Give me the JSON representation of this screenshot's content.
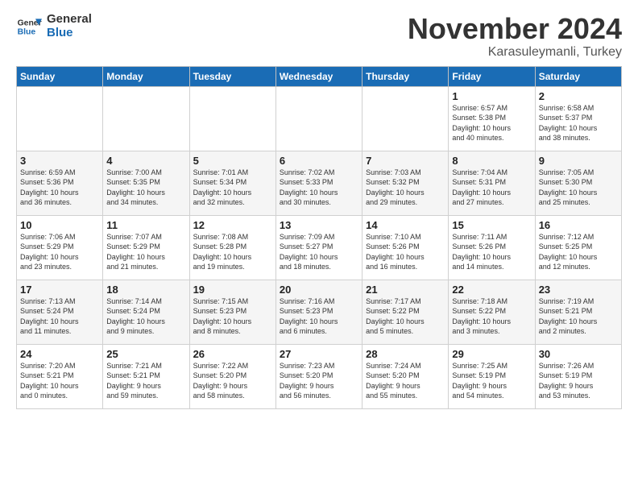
{
  "logo": {
    "line1": "General",
    "line2": "Blue"
  },
  "header": {
    "month": "November 2024",
    "location": "Karasuleymanli, Turkey"
  },
  "days_of_week": [
    "Sunday",
    "Monday",
    "Tuesday",
    "Wednesday",
    "Thursday",
    "Friday",
    "Saturday"
  ],
  "weeks": [
    [
      {
        "day": "",
        "info": ""
      },
      {
        "day": "",
        "info": ""
      },
      {
        "day": "",
        "info": ""
      },
      {
        "day": "",
        "info": ""
      },
      {
        "day": "",
        "info": ""
      },
      {
        "day": "1",
        "info": "Sunrise: 6:57 AM\nSunset: 5:38 PM\nDaylight: 10 hours\nand 40 minutes."
      },
      {
        "day": "2",
        "info": "Sunrise: 6:58 AM\nSunset: 5:37 PM\nDaylight: 10 hours\nand 38 minutes."
      }
    ],
    [
      {
        "day": "3",
        "info": "Sunrise: 6:59 AM\nSunset: 5:36 PM\nDaylight: 10 hours\nand 36 minutes."
      },
      {
        "day": "4",
        "info": "Sunrise: 7:00 AM\nSunset: 5:35 PM\nDaylight: 10 hours\nand 34 minutes."
      },
      {
        "day": "5",
        "info": "Sunrise: 7:01 AM\nSunset: 5:34 PM\nDaylight: 10 hours\nand 32 minutes."
      },
      {
        "day": "6",
        "info": "Sunrise: 7:02 AM\nSunset: 5:33 PM\nDaylight: 10 hours\nand 30 minutes."
      },
      {
        "day": "7",
        "info": "Sunrise: 7:03 AM\nSunset: 5:32 PM\nDaylight: 10 hours\nand 29 minutes."
      },
      {
        "day": "8",
        "info": "Sunrise: 7:04 AM\nSunset: 5:31 PM\nDaylight: 10 hours\nand 27 minutes."
      },
      {
        "day": "9",
        "info": "Sunrise: 7:05 AM\nSunset: 5:30 PM\nDaylight: 10 hours\nand 25 minutes."
      }
    ],
    [
      {
        "day": "10",
        "info": "Sunrise: 7:06 AM\nSunset: 5:29 PM\nDaylight: 10 hours\nand 23 minutes."
      },
      {
        "day": "11",
        "info": "Sunrise: 7:07 AM\nSunset: 5:29 PM\nDaylight: 10 hours\nand 21 minutes."
      },
      {
        "day": "12",
        "info": "Sunrise: 7:08 AM\nSunset: 5:28 PM\nDaylight: 10 hours\nand 19 minutes."
      },
      {
        "day": "13",
        "info": "Sunrise: 7:09 AM\nSunset: 5:27 PM\nDaylight: 10 hours\nand 18 minutes."
      },
      {
        "day": "14",
        "info": "Sunrise: 7:10 AM\nSunset: 5:26 PM\nDaylight: 10 hours\nand 16 minutes."
      },
      {
        "day": "15",
        "info": "Sunrise: 7:11 AM\nSunset: 5:26 PM\nDaylight: 10 hours\nand 14 minutes."
      },
      {
        "day": "16",
        "info": "Sunrise: 7:12 AM\nSunset: 5:25 PM\nDaylight: 10 hours\nand 12 minutes."
      }
    ],
    [
      {
        "day": "17",
        "info": "Sunrise: 7:13 AM\nSunset: 5:24 PM\nDaylight: 10 hours\nand 11 minutes."
      },
      {
        "day": "18",
        "info": "Sunrise: 7:14 AM\nSunset: 5:24 PM\nDaylight: 10 hours\nand 9 minutes."
      },
      {
        "day": "19",
        "info": "Sunrise: 7:15 AM\nSunset: 5:23 PM\nDaylight: 10 hours\nand 8 minutes."
      },
      {
        "day": "20",
        "info": "Sunrise: 7:16 AM\nSunset: 5:23 PM\nDaylight: 10 hours\nand 6 minutes."
      },
      {
        "day": "21",
        "info": "Sunrise: 7:17 AM\nSunset: 5:22 PM\nDaylight: 10 hours\nand 5 minutes."
      },
      {
        "day": "22",
        "info": "Sunrise: 7:18 AM\nSunset: 5:22 PM\nDaylight: 10 hours\nand 3 minutes."
      },
      {
        "day": "23",
        "info": "Sunrise: 7:19 AM\nSunset: 5:21 PM\nDaylight: 10 hours\nand 2 minutes."
      }
    ],
    [
      {
        "day": "24",
        "info": "Sunrise: 7:20 AM\nSunset: 5:21 PM\nDaylight: 10 hours\nand 0 minutes."
      },
      {
        "day": "25",
        "info": "Sunrise: 7:21 AM\nSunset: 5:21 PM\nDaylight: 9 hours\nand 59 minutes."
      },
      {
        "day": "26",
        "info": "Sunrise: 7:22 AM\nSunset: 5:20 PM\nDaylight: 9 hours\nand 58 minutes."
      },
      {
        "day": "27",
        "info": "Sunrise: 7:23 AM\nSunset: 5:20 PM\nDaylight: 9 hours\nand 56 minutes."
      },
      {
        "day": "28",
        "info": "Sunrise: 7:24 AM\nSunset: 5:20 PM\nDaylight: 9 hours\nand 55 minutes."
      },
      {
        "day": "29",
        "info": "Sunrise: 7:25 AM\nSunset: 5:19 PM\nDaylight: 9 hours\nand 54 minutes."
      },
      {
        "day": "30",
        "info": "Sunrise: 7:26 AM\nSunset: 5:19 PM\nDaylight: 9 hours\nand 53 minutes."
      }
    ]
  ]
}
